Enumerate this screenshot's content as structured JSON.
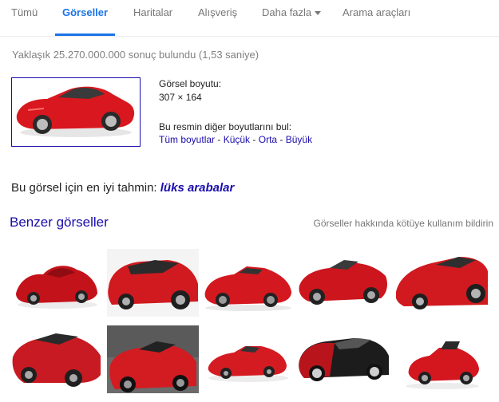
{
  "tabs": [
    {
      "label": "Tümü"
    },
    {
      "label": "Görseller"
    },
    {
      "label": "Haritalar"
    },
    {
      "label": "Alışveriş"
    },
    {
      "label": "Daha fazla"
    },
    {
      "label": "Arama araçları"
    }
  ],
  "stats": "Yaklaşık 25.270.000.000 sonuç bulundu (1,53 saniye)",
  "image_info": {
    "size_label": "Görsel boyutu:",
    "size_value": "307 × 164",
    "other_sizes_label": "Bu resmin diğer boyutlarını bul:",
    "links": [
      "Tüm boyutlar",
      "Küçük",
      "Orta",
      "Büyük"
    ],
    "separator": " - "
  },
  "best_guess": {
    "prefix": "Bu görsel için en iyi tahmin: ",
    "query": "lüks arabalar"
  },
  "similar": {
    "title": "Benzer görseller",
    "report_link": "Görseller hakkında kötüye kullanım bildirin"
  },
  "colors": {
    "accent_blue": "#1a73e8",
    "link_blue": "#1a0dab",
    "car_red": "#d8181e"
  }
}
